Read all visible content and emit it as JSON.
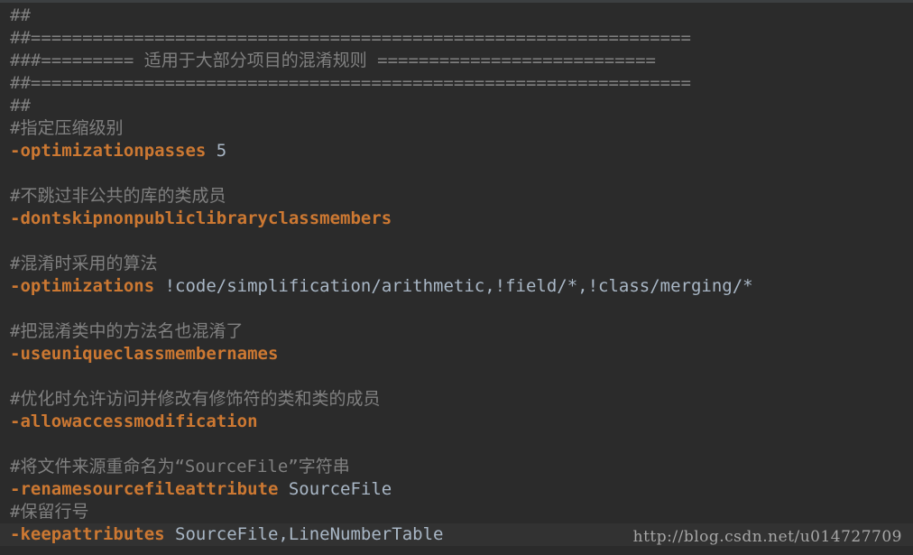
{
  "lines": [
    {
      "comment": "##"
    },
    {
      "comment": "##================================================================"
    },
    {
      "comment": "###========= 适用于大部分项目的混淆规则 ==========================="
    },
    {
      "comment": "##================================================================"
    },
    {
      "comment": "##"
    },
    {
      "comment": "#指定压缩级别"
    },
    {
      "keyword": "-optimizationpasses",
      "arg": " 5"
    },
    {
      "comment": ""
    },
    {
      "comment": "#不跳过非公共的库的类成员"
    },
    {
      "keyword": "-dontskipnonpubliclibraryclassmembers",
      "arg": ""
    },
    {
      "comment": ""
    },
    {
      "comment": "#混淆时采用的算法"
    },
    {
      "keyword": "-optimizations",
      "arg": " !code/simplification/arithmetic,!field/*,!class/merging/*"
    },
    {
      "comment": ""
    },
    {
      "comment": "#把混淆类中的方法名也混淆了"
    },
    {
      "keyword": "-useuniqueclassmembernames",
      "arg": ""
    },
    {
      "comment": ""
    },
    {
      "comment": "#优化时允许访问并修改有修饰符的类和类的成员"
    },
    {
      "keyword": "-allowaccessmodification",
      "arg": ""
    },
    {
      "comment": ""
    },
    {
      "comment": "#将文件来源重命名为“SourceFile”字符串"
    },
    {
      "keyword": "-renamesourcefileattribute",
      "arg": " SourceFile"
    },
    {
      "comment": "#保留行号"
    },
    {
      "keyword": "-keepattributes",
      "arg": " SourceFile,LineNumberTable"
    }
  ],
  "watermark": "http://blog.csdn.net/u014727709",
  "colors": {
    "background": "#2b2b2b",
    "comment": "#808080",
    "keyword": "#cc7832",
    "text": "#a9b7c6"
  }
}
